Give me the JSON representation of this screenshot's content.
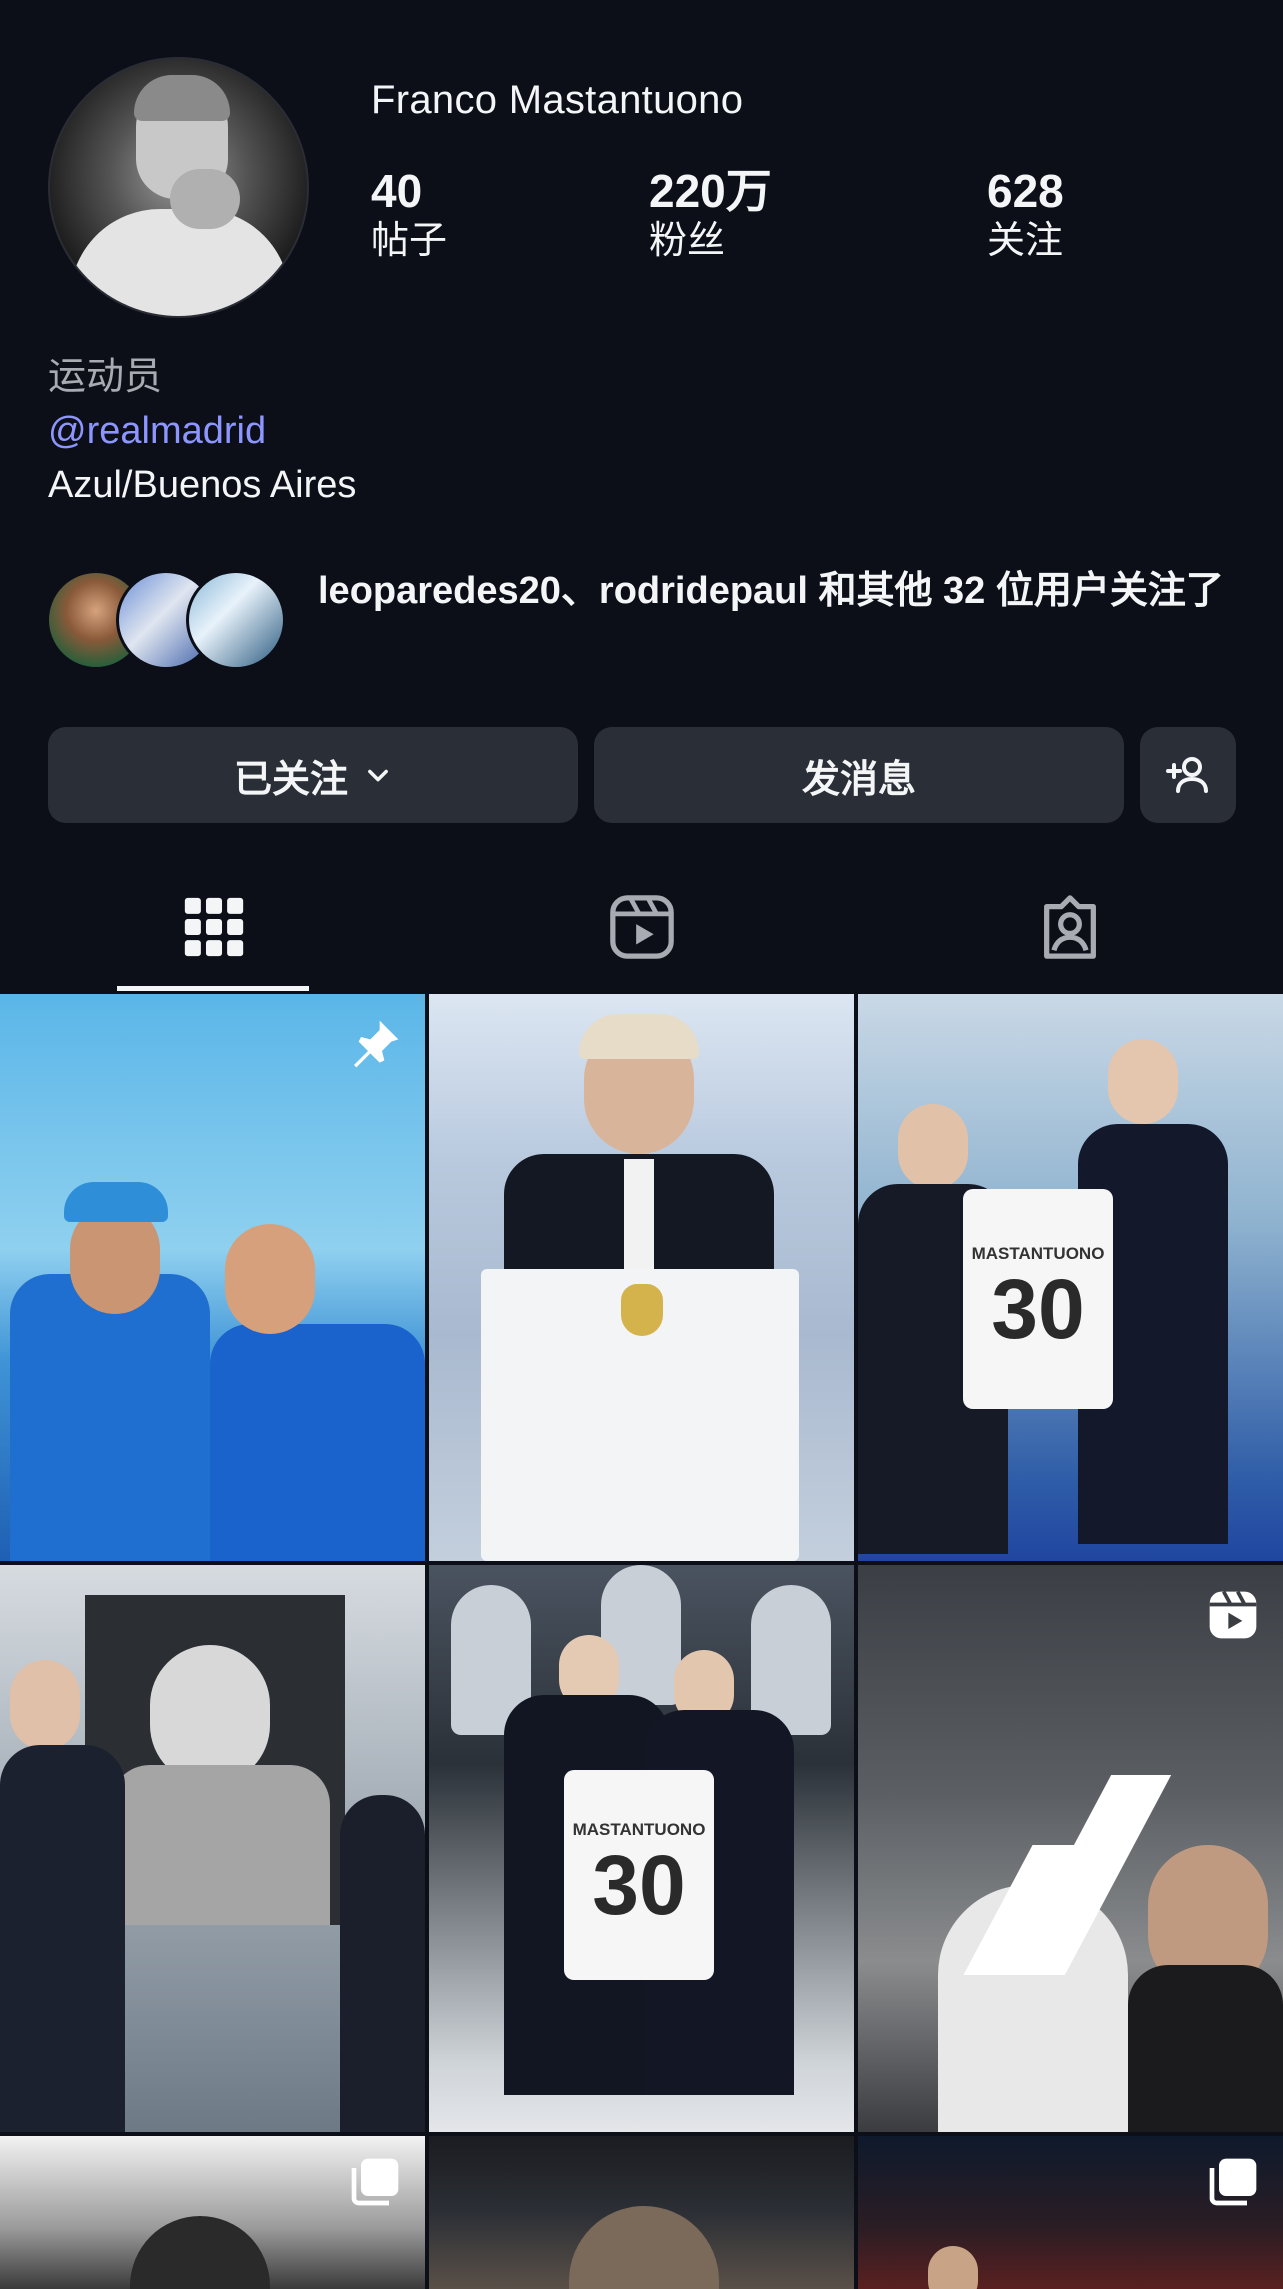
{
  "profile": {
    "username": "Franco Mastantuono",
    "stats": {
      "posts": {
        "value": "40",
        "label": "帖子"
      },
      "followers": {
        "value": "220万",
        "label": "粉丝"
      },
      "following": {
        "value": "628",
        "label": "关注"
      }
    },
    "bio": {
      "category": "运动员",
      "mention": "@realmadrid",
      "location": "Azul/Buenos Aires"
    },
    "mutual_followers_text": "leoparedes20、rodridepaul 和其他 32 位用户关注了"
  },
  "actions": {
    "following_label": "已关注",
    "message_label": "发消息",
    "add_user_icon": "add-person-icon"
  },
  "tabs": [
    {
      "name": "posts",
      "icon": "grid-icon",
      "active": true
    },
    {
      "name": "reels",
      "icon": "reels-icon",
      "active": false
    },
    {
      "name": "tagged",
      "icon": "tagged-person-icon",
      "active": false
    }
  ],
  "grid": {
    "posts": [
      {
        "overlay": "pin-icon"
      },
      {
        "overlay": ""
      },
      {
        "overlay": "",
        "jersey_text": "MASTANTUONO",
        "jersey_number": "30"
      },
      {
        "overlay": ""
      },
      {
        "overlay": "",
        "jersey_text": "MASTANTUONO",
        "jersey_number": "30"
      },
      {
        "overlay": "reels-icon"
      },
      {
        "overlay": "carousel-icon"
      },
      {
        "overlay": ""
      },
      {
        "overlay": "carousel-icon"
      }
    ]
  },
  "colors": {
    "background": "#0c0f18",
    "button": "#2a2e37",
    "mention": "#8d95ff",
    "muted": "#a8abb2"
  }
}
